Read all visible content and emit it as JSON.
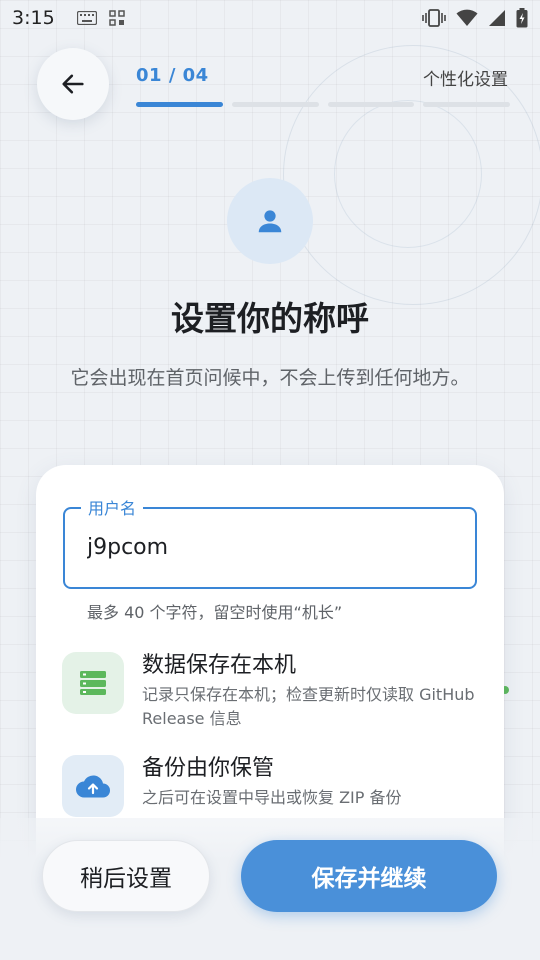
{
  "status_bar": {
    "time": "3:15"
  },
  "header": {
    "step": "01 / 04",
    "step_title": "个性化设置",
    "progress_total": 4,
    "progress_current": 1
  },
  "main": {
    "title": "设置你的称呼",
    "subtitle": "它会出现在首页问候中，不会上传到任何地方。"
  },
  "form": {
    "username_label": "用户名",
    "username_value": "j9pcom",
    "helper": "最多 40 个字符，留空时使用“机长”"
  },
  "features": [
    {
      "icon": "storage-icon",
      "title": "数据保存在本机",
      "desc": "记录只保存在本机；检查更新时仅读取 GitHub Release 信息"
    },
    {
      "icon": "cloud-upload-icon",
      "title": "备份由你保管",
      "desc": "之后可在设置中导出或恢复 ZIP 备份"
    }
  ],
  "actions": {
    "later_label": "稍后设置",
    "save_label": "保存并继续"
  },
  "colors": {
    "accent": "#3a86d6",
    "primary_button": "#4a90d9",
    "green_icon": "#5cb85c"
  }
}
